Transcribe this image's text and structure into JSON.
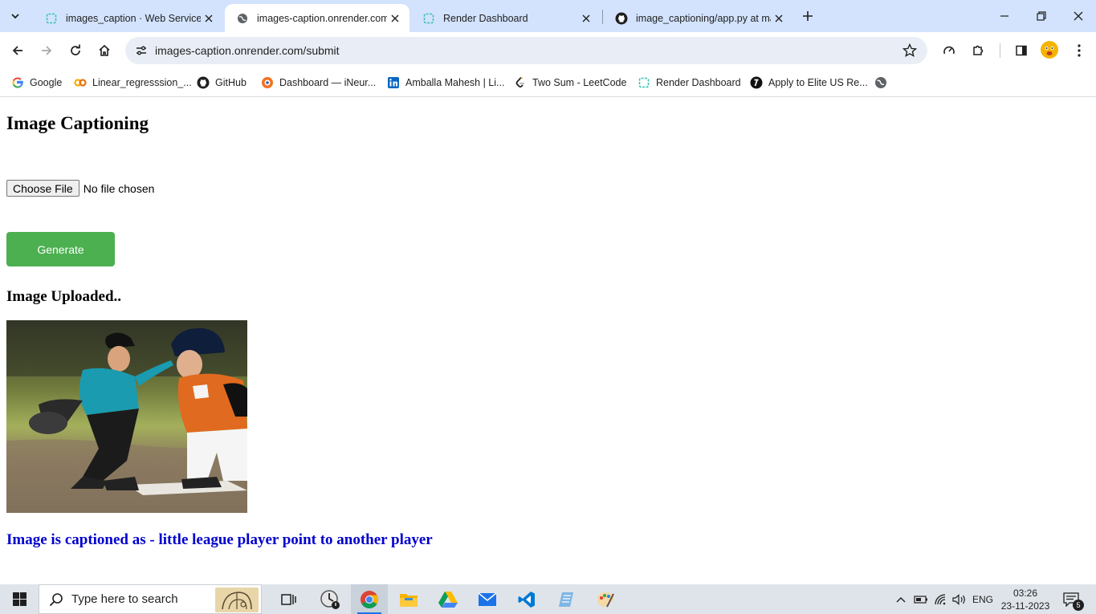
{
  "browser": {
    "tabs": [
      {
        "title": "images_caption · Web Service",
        "icon": "render-icon"
      },
      {
        "title": "images-caption.onrender.com/s",
        "icon": "globe-icon"
      },
      {
        "title": "Render Dashboard",
        "icon": "render-icon"
      },
      {
        "title": "image_captioning/app.py at ma",
        "icon": "github-icon"
      }
    ],
    "address_bar": {
      "url": "images-caption.onrender.com/submit"
    },
    "bookmarks": [
      {
        "label": "Google",
        "icon": "google-icon"
      },
      {
        "label": "Linear_regresssion_...",
        "icon": "colab-icon"
      },
      {
        "label": "GitHub",
        "icon": "github-icon"
      },
      {
        "label": "Dashboard — iNeur...",
        "icon": "ineuron-icon"
      },
      {
        "label": "Amballa Mahesh | Li...",
        "icon": "linkedin-icon"
      },
      {
        "label": "Two Sum - LeetCode",
        "icon": "leetcode-icon"
      },
      {
        "label": "Render Dashboard",
        "icon": "render-icon"
      },
      {
        "label": "Apply to Elite US Re...",
        "icon": "turing-icon"
      }
    ]
  },
  "page": {
    "heading": "Image Captioning",
    "file_input": {
      "button_label": "Choose File",
      "status": "No file chosen"
    },
    "generate_label": "Generate",
    "uploaded_heading": "Image Uploaded..",
    "caption": "Image is captioned as - little league player point to another player"
  },
  "taskbar": {
    "search_placeholder": "Type here to search",
    "language": "ENG",
    "time": "03:26",
    "date": "23-11-2023",
    "notification_count": "5"
  },
  "colors": {
    "tabstrip": "#d3e3fd",
    "generate_button": "#4caf50",
    "caption_text": "#0000cd"
  }
}
